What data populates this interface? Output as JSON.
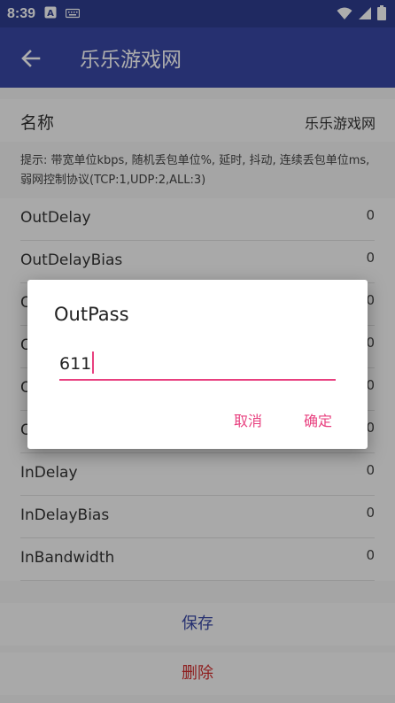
{
  "status_bar": {
    "time": "8:39"
  },
  "app_bar": {
    "title": "乐乐游戏网"
  },
  "name_row": {
    "label": "名称",
    "value": "乐乐游戏网"
  },
  "hint": "提示: 带宽单位kbps, 随机丢包单位%, 延时, 抖动, 连续丢包单位ms, 弱网控制协议(TCP:1,UDP:2,ALL:3)",
  "params": [
    {
      "label": "OutDelay",
      "value": "0"
    },
    {
      "label": "OutDelayBias",
      "value": "0"
    },
    {
      "label": "O",
      "value": "0"
    },
    {
      "label": "O",
      "value": "0"
    },
    {
      "label": "O",
      "value": "0"
    },
    {
      "label": "O",
      "value": "0"
    },
    {
      "label": "InDelay",
      "value": "0"
    },
    {
      "label": "InDelayBias",
      "value": "0"
    },
    {
      "label": "InBandwidth",
      "value": "0"
    }
  ],
  "actions": {
    "save_label": "保存",
    "delete_label": "删除"
  },
  "dialog": {
    "title": "OutPass",
    "input_value": "611",
    "cancel_label": "取消",
    "ok_label": "确定"
  },
  "colors": {
    "primary": "#3948a5",
    "primary_dark": "#2e3d8f",
    "accent": "#e8407f",
    "danger": "#d12d2d"
  }
}
